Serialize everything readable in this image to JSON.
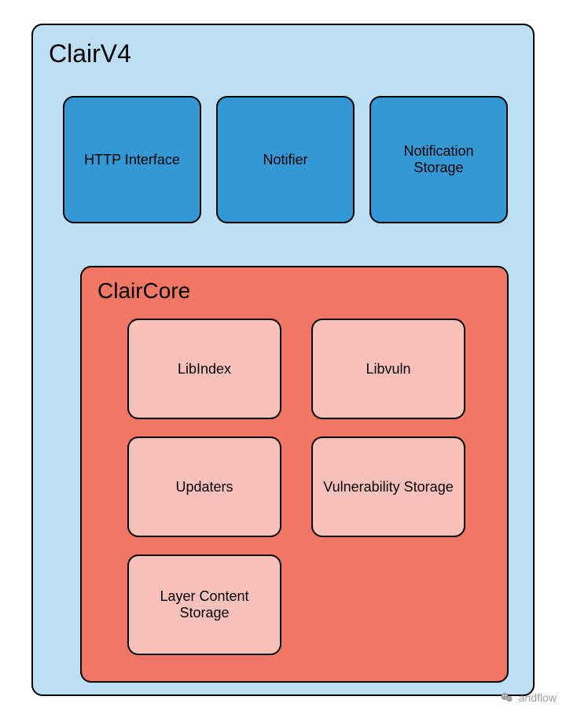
{
  "outer": {
    "title": "ClairV4",
    "boxes": [
      {
        "label": "HTTP Interface"
      },
      {
        "label": "Notifier"
      },
      {
        "label": "Notification Storage"
      }
    ]
  },
  "inner": {
    "title": "ClairCore",
    "boxes": [
      {
        "label": "LibIndex"
      },
      {
        "label": "Libvuln"
      },
      {
        "label": "Updaters"
      },
      {
        "label": "Vulnerability Storage"
      },
      {
        "label": "Layer Content Storage"
      }
    ]
  },
  "watermark": {
    "text": "andflow"
  }
}
